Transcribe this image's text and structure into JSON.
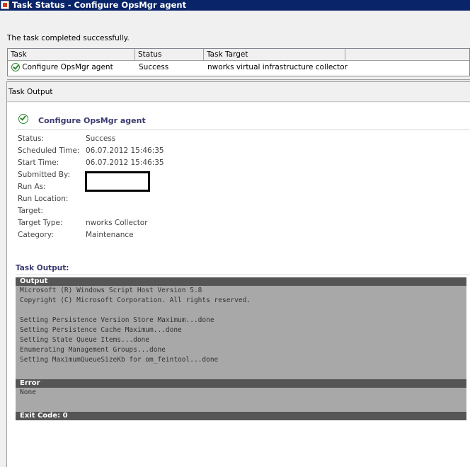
{
  "window": {
    "title": "Task Status - Configure OpsMgr agent"
  },
  "message": "The task completed successfully.",
  "grid": {
    "columns": [
      "Task",
      "Status",
      "Task Target"
    ],
    "rows": [
      {
        "task": "Configure OpsMgr agent",
        "status": "Success",
        "target": "nworks virtual infrastructure collector"
      }
    ]
  },
  "task_output_header": "Task Output",
  "detail": {
    "title": "Configure OpsMgr agent",
    "fields": [
      {
        "label": "Status:",
        "value": "Success"
      },
      {
        "label": "Scheduled Time:",
        "value": "06.07.2012 15:46:35"
      },
      {
        "label": "Start Time:",
        "value": "06.07.2012 15:46:35"
      },
      {
        "label": "Submitted By:",
        "value": ""
      },
      {
        "label": "Run As:",
        "value": ""
      },
      {
        "label": "Run Location:",
        "value": ""
      },
      {
        "label": "Target:",
        "value": ""
      },
      {
        "label": "Target Type:",
        "value": "nworks Collector"
      },
      {
        "label": "Category:",
        "value": "Maintenance"
      }
    ],
    "task_output_label": "Task Output:",
    "output_header": "Output",
    "output_lines": [
      "Microsoft (R) Windows Script Host Version 5.8",
      "Copyright (C) Microsoft Corporation. All rights reserved.",
      "",
      "Setting Persistence Version Store Maximum...done",
      "Setting Persistence Cache Maximum...done",
      "Setting State Queue Items...done",
      "Enumerating Management Groups...done",
      "Setting MaximumQueueSizeKb for om_feintool...done"
    ],
    "error_header": "Error",
    "error_text": "None",
    "exit_code": "Exit Code: 0"
  },
  "colors": {
    "titlebar": "#0a246a",
    "success_icon": "#2f8a2f",
    "panel_header": "#555555",
    "panel_body": "#a8a8a8",
    "heading": "#3a3a70"
  }
}
